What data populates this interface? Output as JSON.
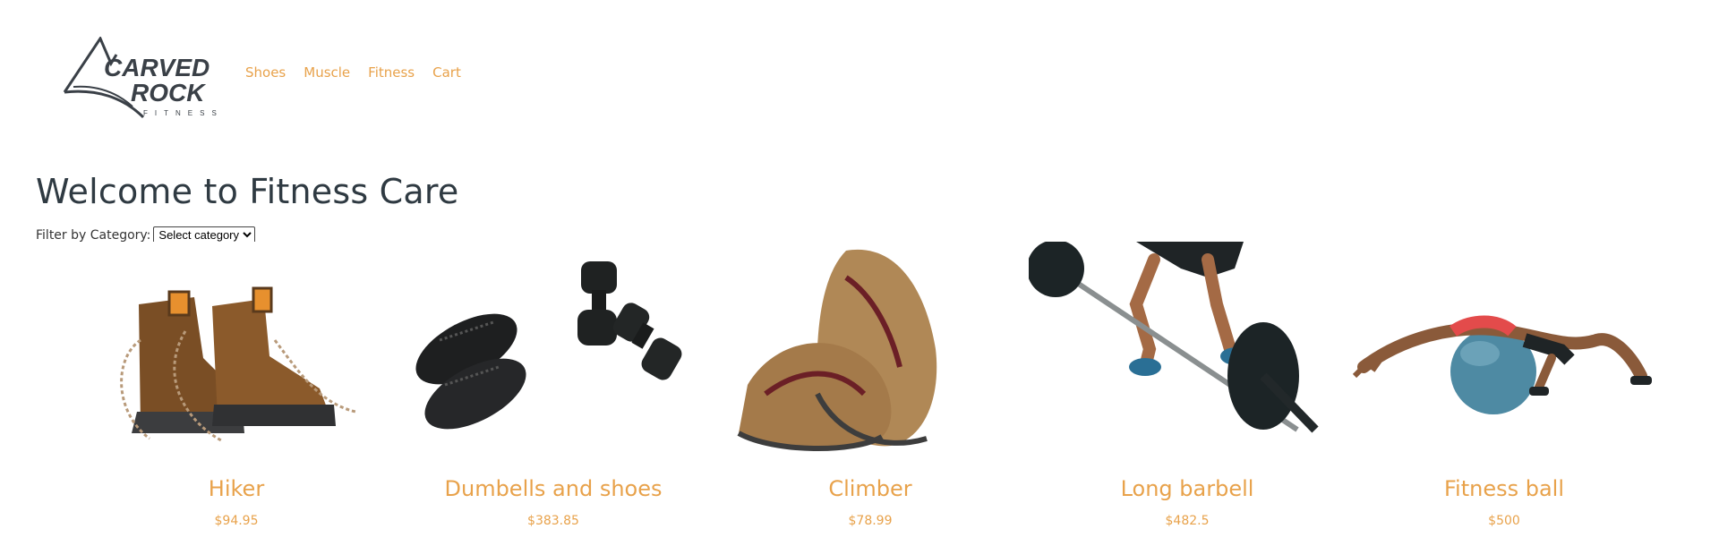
{
  "brand": {
    "logo_name": "carved-rock-fitness-logo",
    "logo_line1": "CARVED",
    "logo_line2": "ROCK",
    "logo_line3": "FITNESS"
  },
  "nav": [
    {
      "label": "Shoes"
    },
    {
      "label": "Muscle"
    },
    {
      "label": "Fitness"
    },
    {
      "label": "Cart"
    }
  ],
  "page": {
    "title": "Welcome to Fitness Care"
  },
  "filter": {
    "label": "Filter by Category:",
    "selected": "Select category"
  },
  "products": [
    {
      "name": "Hiker",
      "price": "$94.95",
      "image": "hiking-boots"
    },
    {
      "name": "Dumbells and shoes",
      "price": "$383.85",
      "image": "dumbbells-and-shoes"
    },
    {
      "name": "Climber",
      "price": "$78.99",
      "image": "sandals"
    },
    {
      "name": "Long barbell",
      "price": "$482.5",
      "image": "barbell-lift"
    },
    {
      "name": "Fitness ball",
      "price": "$500",
      "image": "fitness-ball-stretch"
    }
  ],
  "colors": {
    "accent": "#e8a24b",
    "heading": "#2f3a42",
    "logo": "#3a4047"
  }
}
